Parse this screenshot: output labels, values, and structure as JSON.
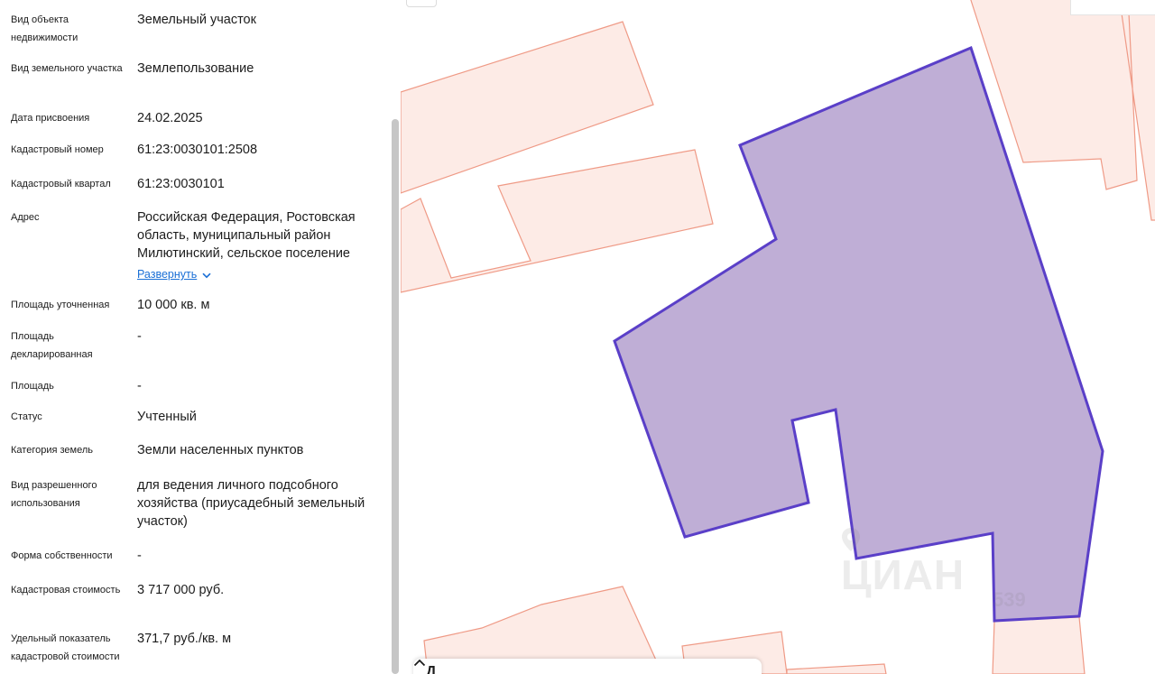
{
  "properties": [
    {
      "label": "Вид объекта недвижимости",
      "value": "Земельный участок"
    },
    {
      "label": "Вид земельного участка",
      "value": "Землепользование"
    },
    {
      "label": "Дата присвоения",
      "value": "24.02.2025"
    },
    {
      "label": "Кадастровый номер",
      "value": "61:23:0030101:2508"
    },
    {
      "label": "Кадастровый квартал",
      "value": "61:23:0030101"
    },
    {
      "label": "Адрес",
      "value": "Российская Федерация, Ростовская область, муниципальный район Милютинский, сельское поселение"
    },
    {
      "label": "Площадь уточненная",
      "value": "10 000 кв. м"
    },
    {
      "label": "Площадь декларированная",
      "value": "-"
    },
    {
      "label": "Площадь",
      "value": "-"
    },
    {
      "label": "Статус",
      "value": "Учтенный"
    },
    {
      "label": "Категория земель",
      "value": "Земли населенных пунктов"
    },
    {
      "label": "Вид разрешенного использования",
      "value": "для ведения личного подсобного хозяйства (приусадебный земельный участок)"
    },
    {
      "label": "Форма собственности",
      "value": "-"
    },
    {
      "label": "Кадастровая стоимость",
      "value": "3 717 000 руб."
    },
    {
      "label": "Удельный показатель кадастровой стоимости",
      "value": "371,7 руб./кв. м"
    }
  ],
  "address_expand_label": "Развернуть",
  "bottom_sheet_letter": "Д",
  "watermark": {
    "text": "ЦИАН",
    "number": "539"
  },
  "colors": {
    "selected_fill": "#bfaed6",
    "selected_stroke": "#5a3fc8",
    "parcel_fill": "#fdebe6",
    "parcel_stroke": "#ef9a86",
    "link": "#1a6fd6"
  },
  "icons": [
    "chevron-down-icon",
    "chevron-up-icon",
    "location-pin-icon"
  ]
}
